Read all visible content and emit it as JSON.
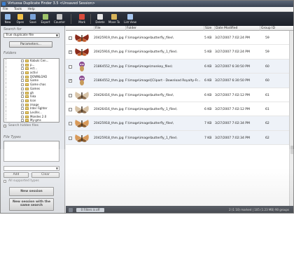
{
  "window": {
    "title": "Virtuosa Duplicate Finder 3.5 <Unsaved Session>"
  },
  "menu": [
    "File",
    "Tools",
    "Help"
  ],
  "toolbar": [
    {
      "label": "New",
      "icon": "new-icon",
      "color": "#8fb7e6"
    },
    {
      "label": "Open",
      "icon": "open-icon",
      "color": "#f0c24a"
    },
    {
      "label": "Save",
      "icon": "save-icon",
      "color": "#7aa2d8"
    },
    {
      "label": "Export",
      "icon": "export-icon",
      "color": "#9ec36a"
    },
    {
      "label": "Counter",
      "icon": "counter-icon",
      "color": "#c8c8c8"
    },
    {
      "label": "Mark",
      "icon": "mark-icon",
      "color": "#d94b3d"
    },
    {
      "label": "Delete",
      "icon": "delete-icon",
      "color": "#e8e8e8"
    },
    {
      "label": "Move To",
      "icon": "move-icon",
      "color": "#d8b45a"
    },
    {
      "label": "List View",
      "icon": "list-view-icon",
      "color": "#a8c8f0"
    }
  ],
  "left_panel": {
    "search_for_title": "Search for",
    "search_for_value": "True duplicate file",
    "parameters_label": "Parameters...",
    "folders_title": "Folders",
    "folders": [
      "Kabuki Cen...",
      "p...",
      "ect...",
      "activi",
      "DOWNLOAD",
      "Game",
      "Game chas",
      "Games",
      "gh",
      "hika",
      "Icon",
      "image",
      "Irder Fighter",
      "Lesifer...",
      "Mondes 2.0",
      "My-gms",
      "Red-Cane"
    ],
    "search_hidden_label": "Search hidden files",
    "file_types_title": "File Types",
    "add_label": "Add",
    "clear_label": "Clear",
    "all_supported_label": "All supported types",
    "new_session_label": "New session",
    "new_session_same_label": "New session with the same search"
  },
  "table": {
    "columns": [
      "File",
      "Folder",
      "Size",
      "Date Modified",
      "Group ID"
    ],
    "rows": [
      {
        "thumb": "moth-red",
        "checked": false,
        "file": "20425919_thm.jpg",
        "folder": "F:\\image\\image\\butterfly_files\\",
        "size": "5 KB",
        "date": "3/27/2007 7:02:24 PM",
        "group": "59"
      },
      {
        "thumb": "moth-red",
        "checked": true,
        "file": "20425916_thm.jpg",
        "folder": "F:\\image\\image\\butterfly_1_files\\",
        "size": "5 KB",
        "date": "3/27/2007 7:02:24 PM",
        "group": "59"
      },
      {
        "thumb": "monkey",
        "checked": false,
        "file": "21864552_thm.jpg",
        "folder": "F:\\image\\image\\monkey_files\\",
        "size": "6 KB",
        "date": "3/27/2007 6:30:50 PM",
        "group": "60"
      },
      {
        "thumb": "monkey",
        "checked": true,
        "file": "21864552_thm.jpg",
        "folder": "F:\\image\\image\\[Clipart - Download Royalty-Fr...",
        "size": "6 KB",
        "date": "3/27/2007 6:30:50 PM",
        "group": "60"
      },
      {
        "thumb": "moth-pale",
        "checked": false,
        "file": "20426416_thm.jpg",
        "folder": "F:\\image\\image\\butterfly_files\\",
        "size": "6 KB",
        "date": "3/27/2007 7:02:12 PM",
        "group": "61"
      },
      {
        "thumb": "moth-pale",
        "checked": false,
        "file": "20426416_thm.jpg",
        "folder": "F:\\image\\image\\butterfly_1_files\\",
        "size": "6 KB",
        "date": "3/27/2007 7:02:12 PM",
        "group": "61"
      },
      {
        "thumb": "butterfly",
        "checked": false,
        "file": "20425918_thm.jpg",
        "folder": "F:\\image\\image\\butterfly_files\\",
        "size": "7 KB",
        "date": "3/27/2007 7:02:34 PM",
        "group": "62"
      },
      {
        "thumb": "butterfly",
        "checked": false,
        "file": "20425918_thm.jpg",
        "folder": "F:\\image\\image\\butterfly_1_files\\",
        "size": "7 KB",
        "date": "3/27/2007 7:02:34 PM",
        "group": "62"
      }
    ]
  },
  "bottom": {
    "filter_label": "0 Filters is off",
    "status": "2 (1 10) marked | 105 (1.23 MB) 90 groups"
  }
}
